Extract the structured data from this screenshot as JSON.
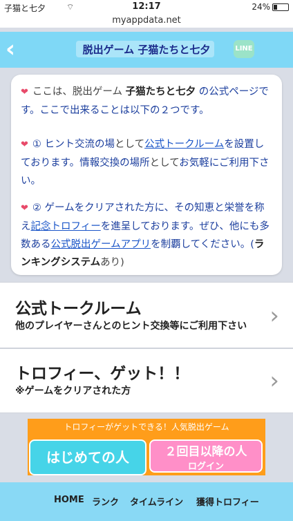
{
  "status": {
    "carrier": "子猫と七夕",
    "time": "12:17",
    "battery": "24%"
  },
  "url": "myappdata.net",
  "nav": {
    "back_icon": "chevron-left-icon",
    "title": "脱出ゲーム 子猫たちと七夕",
    "line_icon": "LINE"
  },
  "intro": {
    "p1": [
      "ここは、脱出ゲーム ",
      "子猫たちと七夕",
      " の公式ページです。ここで出来ることは以下の２つです。"
    ],
    "p2": [
      "① ヒント交流の場",
      "として",
      "公式トークルーム",
      "を設置しております。情報交換の場所",
      "として",
      "お気軽にご利用下さい。"
    ],
    "p3": [
      "② ゲームをクリアされた方に、その知恵と栄誉を称え",
      "記念トロフィー",
      "を進呈しております。ぜひ、他にも多数ある",
      "公式脱出ゲームアプリ",
      "を制覇してください。(",
      "ランキングシステム",
      "あり)"
    ]
  },
  "menu": [
    {
      "title": "公式トークルーム",
      "subtitle": "他のプレイヤーさんとのヒント交換等にご利用下さい"
    },
    {
      "title": "トロフィー、ゲット！！",
      "subtitle": "※ゲームをクリアされた方"
    }
  ],
  "banner": {
    "text": "トロフィーがゲットできる！人気脱出ゲーム",
    "first_button": "はじめての人",
    "second_button": "２回目以降の人",
    "second_button_sub": "ログイン"
  },
  "tabs": [
    "HOME",
    "ランク",
    "タイムライン",
    "獲得トロフィー"
  ],
  "colors": {
    "nav": "#7fd8f6",
    "heart": "#e84a6a",
    "link": "#1a55c8",
    "banner": "#ff9d1a"
  }
}
